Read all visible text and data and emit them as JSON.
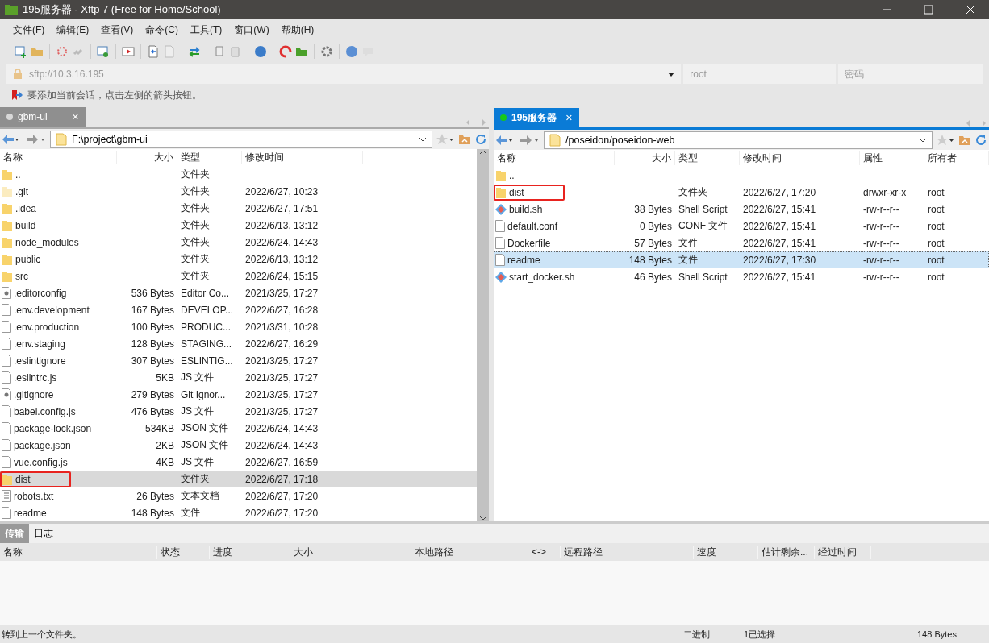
{
  "window": {
    "title": "195服务器 - Xftp 7 (Free for Home/School)"
  },
  "menu": [
    "文件(F)",
    "编辑(E)",
    "查看(V)",
    "命令(C)",
    "工具(T)",
    "窗口(W)",
    "帮助(H)"
  ],
  "address": {
    "url": "sftp://10.3.16.195",
    "user_placeholder": "root",
    "password_placeholder": "密码"
  },
  "hint": "要添加当前会话，点击左侧的箭头按钮。",
  "panes": [
    {
      "tab": {
        "label": "gbm-ui",
        "close": "✕",
        "selected": false,
        "connected": false
      },
      "path": "F:\\project\\gbm-ui",
      "columns": [
        "名称",
        "大小",
        "类型",
        "修改时间"
      ],
      "rows": [
        {
          "kind": "folder",
          "cells": [
            "..",
            " ",
            "文件夹",
            " "
          ],
          "selected": false,
          "annotated": false
        },
        {
          "kind": "hidden_folder",
          "cells": [
            ".git",
            " ",
            "文件夹",
            "2022/6/27, 10:23"
          ],
          "selected": false,
          "annotated": false
        },
        {
          "kind": "folder",
          "cells": [
            ".idea",
            " ",
            "文件夹",
            "2022/6/27, 17:51"
          ],
          "selected": false,
          "annotated": false
        },
        {
          "kind": "folder",
          "cells": [
            "build",
            " ",
            "文件夹",
            "2022/6/13, 13:12"
          ],
          "selected": false,
          "annotated": false
        },
        {
          "kind": "folder",
          "cells": [
            "node_modules",
            " ",
            "文件夹",
            "2022/6/24, 14:43"
          ],
          "selected": false,
          "annotated": false
        },
        {
          "kind": "folder",
          "cells": [
            "public",
            " ",
            "文件夹",
            "2022/6/13, 13:12"
          ],
          "selected": false,
          "annotated": false
        },
        {
          "kind": "folder",
          "cells": [
            "src",
            " ",
            "文件夹",
            "2022/6/24, 15:15"
          ],
          "selected": false,
          "annotated": false
        },
        {
          "kind": "config",
          "cells": [
            ".editorconfig",
            "536 Bytes",
            "Editor Co...",
            "2021/3/25, 17:27"
          ],
          "selected": false,
          "annotated": false
        },
        {
          "kind": "file",
          "cells": [
            ".env.development",
            "167 Bytes",
            "DEVELOP...",
            "2022/6/27, 16:28"
          ],
          "selected": false,
          "annotated": false
        },
        {
          "kind": "file",
          "cells": [
            ".env.production",
            "100 Bytes",
            "PRODUC...",
            "2021/3/31, 10:28"
          ],
          "selected": false,
          "annotated": false
        },
        {
          "kind": "file",
          "cells": [
            ".env.staging",
            "128 Bytes",
            "STAGING...",
            "2022/6/27, 16:29"
          ],
          "selected": false,
          "annotated": false
        },
        {
          "kind": "file",
          "cells": [
            ".eslintignore",
            "307 Bytes",
            "ESLINTIG...",
            "2021/3/25, 17:27"
          ],
          "selected": false,
          "annotated": false
        },
        {
          "kind": "file",
          "cells": [
            ".eslintrc.js",
            "5KB",
            "JS 文件",
            "2021/3/25, 17:27"
          ],
          "selected": false,
          "annotated": false
        },
        {
          "kind": "config",
          "cells": [
            ".gitignore",
            "279 Bytes",
            "Git Ignor...",
            "2021/3/25, 17:27"
          ],
          "selected": false,
          "annotated": false
        },
        {
          "kind": "file",
          "cells": [
            "babel.config.js",
            "476 Bytes",
            "JS 文件",
            "2021/3/25, 17:27"
          ],
          "selected": false,
          "annotated": false
        },
        {
          "kind": "file",
          "cells": [
            "package-lock.json",
            "534KB",
            "JSON 文件",
            "2022/6/24, 14:43"
          ],
          "selected": false,
          "annotated": false
        },
        {
          "kind": "file",
          "cells": [
            "package.json",
            "2KB",
            "JSON 文件",
            "2022/6/24, 14:43"
          ],
          "selected": false,
          "annotated": false
        },
        {
          "kind": "file",
          "cells": [
            "vue.config.js",
            "4KB",
            "JS 文件",
            "2022/6/27, 16:59"
          ],
          "selected": false,
          "annotated": false
        },
        {
          "kind": "folder",
          "cells": [
            "dist",
            " ",
            "文件夹",
            "2022/6/27, 17:18"
          ],
          "selected": true,
          "annotated": true
        },
        {
          "kind": "text",
          "cells": [
            "robots.txt",
            "26 Bytes",
            "文本文档",
            "2022/6/27, 17:20"
          ],
          "selected": false,
          "annotated": false
        },
        {
          "kind": "file",
          "cells": [
            "readme",
            "148 Bytes",
            "文件",
            "2022/6/27, 17:20"
          ],
          "selected": false,
          "annotated": false
        }
      ]
    },
    {
      "tab": {
        "label": "195服务器",
        "close": "✕",
        "selected": true,
        "connected": true
      },
      "path": "/poseidon/poseidon-web",
      "columns": [
        "名称",
        "大小",
        "类型",
        "修改时间",
        "属性",
        "所有者"
      ],
      "rows": [
        {
          "kind": "folder",
          "cells": [
            "..",
            " ",
            " ",
            " ",
            " ",
            " "
          ],
          "selected": false,
          "annotated": false
        },
        {
          "kind": "folder",
          "cells": [
            "dist",
            " ",
            "文件夹",
            "2022/6/27, 17:20",
            "drwxr-xr-x",
            "root"
          ],
          "selected": false,
          "annotated": true
        },
        {
          "kind": "script",
          "cells": [
            "build.sh",
            "38 Bytes",
            "Shell Script",
            "2022/6/27, 15:41",
            "-rw-r--r--",
            "root"
          ],
          "selected": false,
          "annotated": false
        },
        {
          "kind": "file",
          "cells": [
            "default.conf",
            "0 Bytes",
            "CONF 文件",
            "2022/6/27, 15:41",
            "-rw-r--r--",
            "root"
          ],
          "selected": false,
          "annotated": false
        },
        {
          "kind": "file",
          "cells": [
            "Dockerfile",
            "57 Bytes",
            "文件",
            "2022/6/27, 15:41",
            "-rw-r--r--",
            "root"
          ],
          "selected": false,
          "annotated": false
        },
        {
          "kind": "file",
          "cells": [
            "readme",
            "148 Bytes",
            "文件",
            "2022/6/27, 17:30",
            "-rw-r--r--",
            "root"
          ],
          "selected": true,
          "annotated": false
        },
        {
          "kind": "script",
          "cells": [
            "start_docker.sh",
            "46 Bytes",
            "Shell Script",
            "2022/6/27, 15:41",
            "-rw-r--r--",
            "root"
          ],
          "selected": false,
          "annotated": false
        }
      ]
    }
  ],
  "transfer": {
    "tabs": [
      {
        "label": "传输",
        "selected": true
      },
      {
        "label": "日志",
        "selected": false
      }
    ],
    "columns": [
      "名称",
      "状态",
      "进度",
      "大小",
      "本地路径",
      "<->",
      "远程路径",
      "速度",
      "估计剩余...",
      "经过时间"
    ]
  },
  "status_bar": {
    "message": "转到上一个文件夹。",
    "mode": "二进制",
    "selection": "1已选择",
    "size": "148 Bytes"
  }
}
